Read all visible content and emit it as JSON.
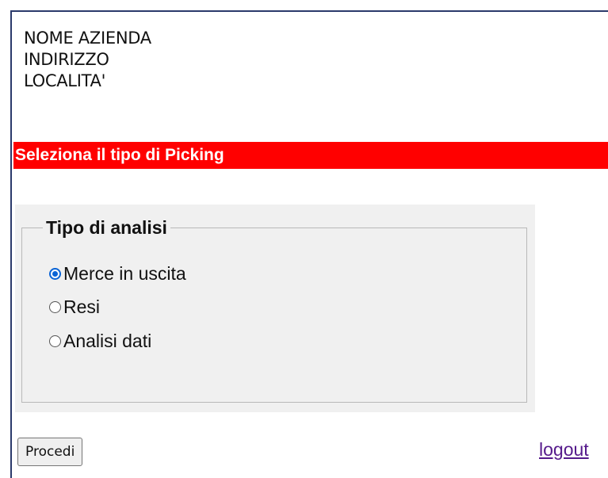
{
  "company": {
    "name": "NOME AZIENDA",
    "address": "INDIRIZZO",
    "city": "LOCALITA'"
  },
  "banner": {
    "text": "Seleziona il tipo di Picking",
    "background": "#ff0000"
  },
  "analysis": {
    "legend": "Tipo di analisi",
    "options": [
      {
        "label": "Merce in uscita",
        "checked": true
      },
      {
        "label": "Resi",
        "checked": false
      },
      {
        "label": "Analisi dati",
        "checked": false
      }
    ]
  },
  "actions": {
    "proceed_label": "Procedi",
    "logout_label": "logout"
  }
}
